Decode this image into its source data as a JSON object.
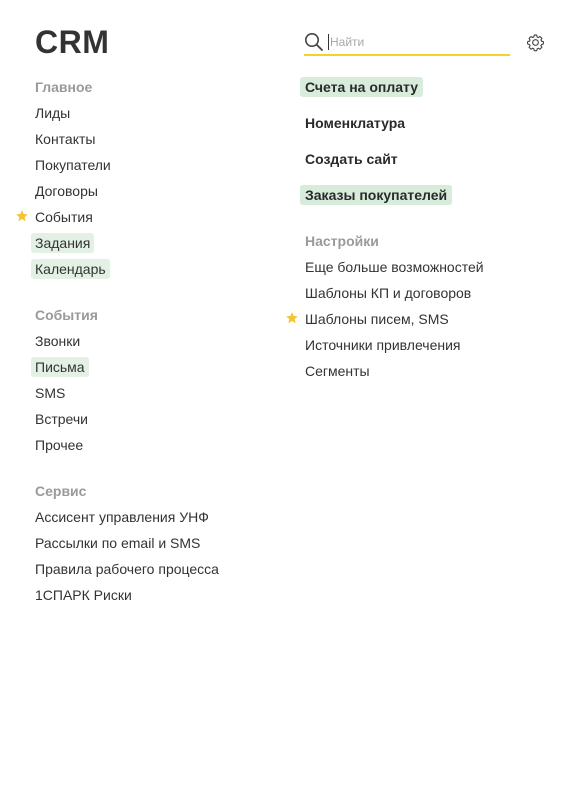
{
  "header": {
    "title": "CRM",
    "search_placeholder": "Найти",
    "settings_icon": "gear-icon"
  },
  "colors": {
    "accent_underline": "#f2d32b",
    "highlight": "#e3f1e5",
    "star": "#f4c531",
    "heading": "#9a9a9a"
  },
  "left": {
    "main": {
      "heading": "Главное",
      "items": [
        {
          "label": "Лиды",
          "favorite": false,
          "highlighted": false
        },
        {
          "label": "Контакты",
          "favorite": false,
          "highlighted": false
        },
        {
          "label": "Покупатели",
          "favorite": false,
          "highlighted": false
        },
        {
          "label": "Договоры",
          "favorite": false,
          "highlighted": false
        },
        {
          "label": "События",
          "favorite": true,
          "highlighted": false
        },
        {
          "label": "Задания",
          "favorite": false,
          "highlighted": true
        },
        {
          "label": "Календарь",
          "favorite": false,
          "highlighted": true
        }
      ]
    },
    "events": {
      "heading": "События",
      "items": [
        {
          "label": "Звонки",
          "favorite": false,
          "highlighted": false
        },
        {
          "label": "Письма",
          "favorite": false,
          "highlighted": true
        },
        {
          "label": "SMS",
          "favorite": false,
          "highlighted": false
        },
        {
          "label": "Встречи",
          "favorite": false,
          "highlighted": false
        },
        {
          "label": "Прочее",
          "favorite": false,
          "highlighted": false
        }
      ]
    },
    "service": {
      "heading": "Сервис",
      "items": [
        {
          "label": "Ассисент управления УНФ"
        },
        {
          "label": "Рассылки по email и SMS"
        },
        {
          "label": "Правила рабочего процесса"
        },
        {
          "label": "1СПАРК Риски"
        }
      ]
    }
  },
  "right": {
    "links": [
      {
        "label": "Счета на оплату",
        "highlighted": true
      },
      {
        "label": "Номенклатура",
        "highlighted": false
      },
      {
        "label": "Создать сайт",
        "highlighted": false
      },
      {
        "label": "Заказы покупателей",
        "highlighted": true
      }
    ],
    "settings": {
      "heading": "Настройки",
      "items": [
        {
          "label": "Еще больше возможностей",
          "favorite": false
        },
        {
          "label": "Шаблоны КП и договоров",
          "favorite": false
        },
        {
          "label": "Шаблоны писем, SMS",
          "favorite": true
        },
        {
          "label": "Источники привлечения",
          "favorite": false
        },
        {
          "label": "Сегменты",
          "favorite": false
        }
      ]
    }
  }
}
